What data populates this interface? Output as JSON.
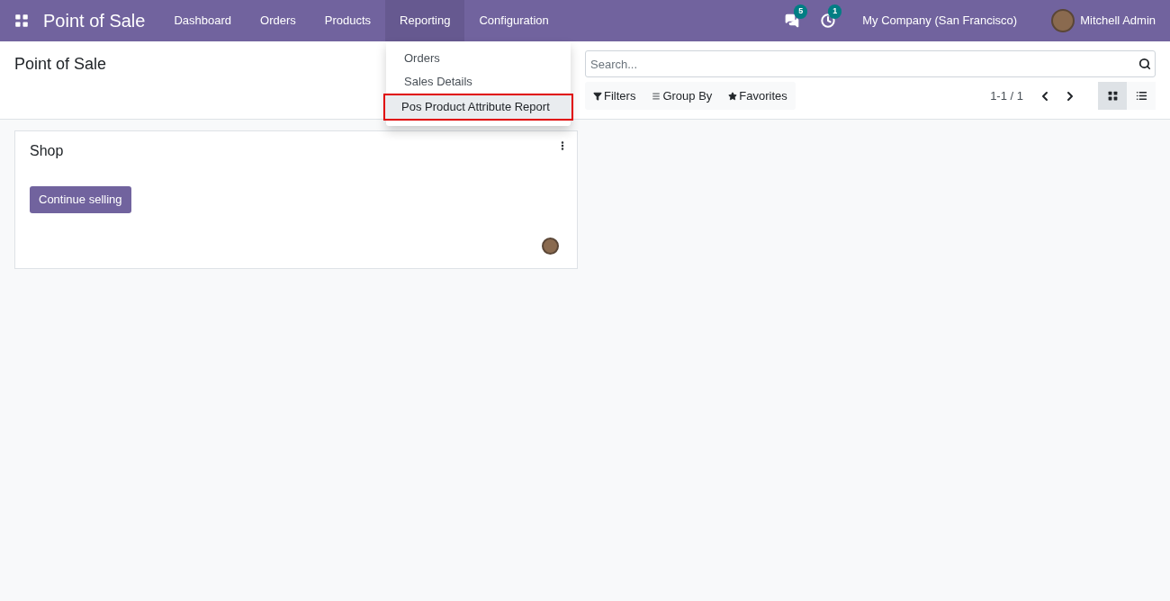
{
  "navbar": {
    "app_title": "Point of Sale",
    "menus": [
      {
        "label": "Dashboard",
        "selected": false
      },
      {
        "label": "Orders",
        "selected": false
      },
      {
        "label": "Products",
        "selected": false
      },
      {
        "label": "Reporting",
        "selected": true
      },
      {
        "label": "Configuration",
        "selected": false
      }
    ],
    "messages_badge": "5",
    "activities_badge": "1",
    "company": "My Company (San Francisco)",
    "user": "Mitchell Admin"
  },
  "dropdown": {
    "items": [
      {
        "label": "Orders",
        "highlighted": false
      },
      {
        "label": "Sales Details",
        "highlighted": false
      },
      {
        "label": "Pos Product Attribute Report",
        "highlighted": true
      }
    ]
  },
  "control_panel": {
    "title": "Point of Sale",
    "search": {
      "placeholder": "Search..."
    },
    "filters": [
      "Filters",
      "Group By",
      "Favorites"
    ],
    "pager": "1-1 / 1",
    "views": [
      {
        "kind": "kanban",
        "selected": true
      },
      {
        "kind": "list",
        "selected": false
      }
    ]
  },
  "cards": [
    {
      "title": "Shop",
      "button": "Continue selling"
    }
  ]
}
